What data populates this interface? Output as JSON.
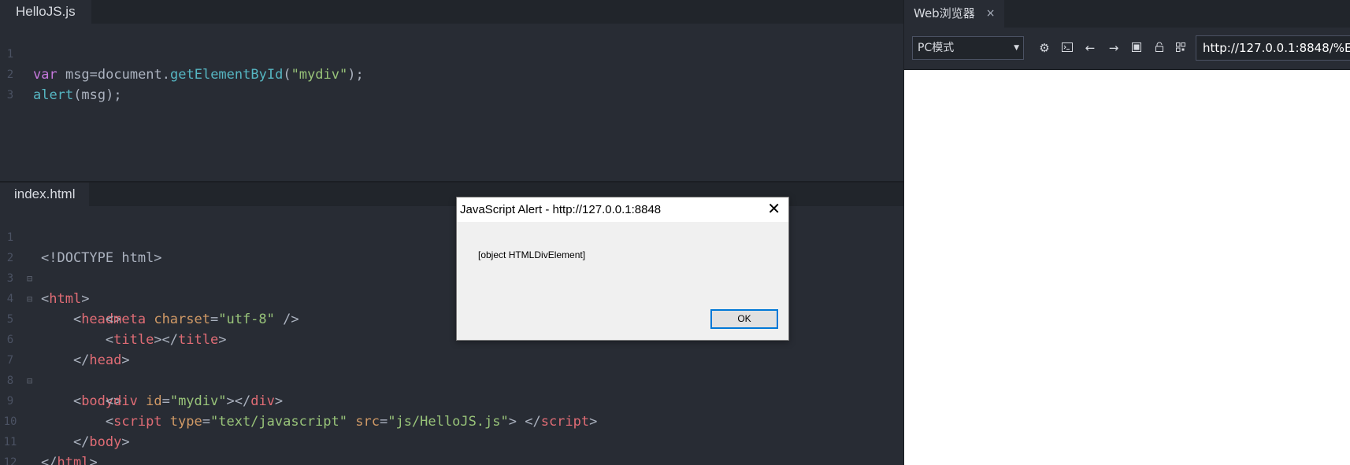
{
  "editor": {
    "top_pane": {
      "tab_label": "HelloJS.js",
      "lines": [
        {
          "num": "1"
        },
        {
          "num": "2"
        },
        {
          "num": "3"
        }
      ]
    },
    "bottom_pane": {
      "tab_label": "index.html",
      "lines": [
        {
          "num": "1"
        },
        {
          "num": "2"
        },
        {
          "num": "3"
        },
        {
          "num": "4"
        },
        {
          "num": "5"
        },
        {
          "num": "6"
        },
        {
          "num": "7"
        },
        {
          "num": "8"
        },
        {
          "num": "9"
        },
        {
          "num": "10"
        },
        {
          "num": "11"
        },
        {
          "num": "12"
        }
      ]
    }
  },
  "browser": {
    "tab_label": "Web浏览器",
    "tab_close": "×",
    "mode": "PC模式",
    "url": "http://127.0.0.1:8848/%E",
    "icons": [
      "settings-icon",
      "console-icon",
      "back-icon",
      "forward-icon",
      "screenshot-icon",
      "lock-icon",
      "qrcode-icon"
    ]
  },
  "alert": {
    "title": "JavaScript Alert - http://127.0.0.1:8848",
    "message": "[object HTMLDivElement]",
    "ok_label": "OK",
    "close_glyph": "✕"
  },
  "colors": {
    "editor_bg": "#282c34",
    "keyword": "#c678dd",
    "function": "#56b6c2",
    "string": "#98c379",
    "tag": "#e06c75",
    "attribute": "#d19a66",
    "ok_focus": "#0078d7"
  }
}
